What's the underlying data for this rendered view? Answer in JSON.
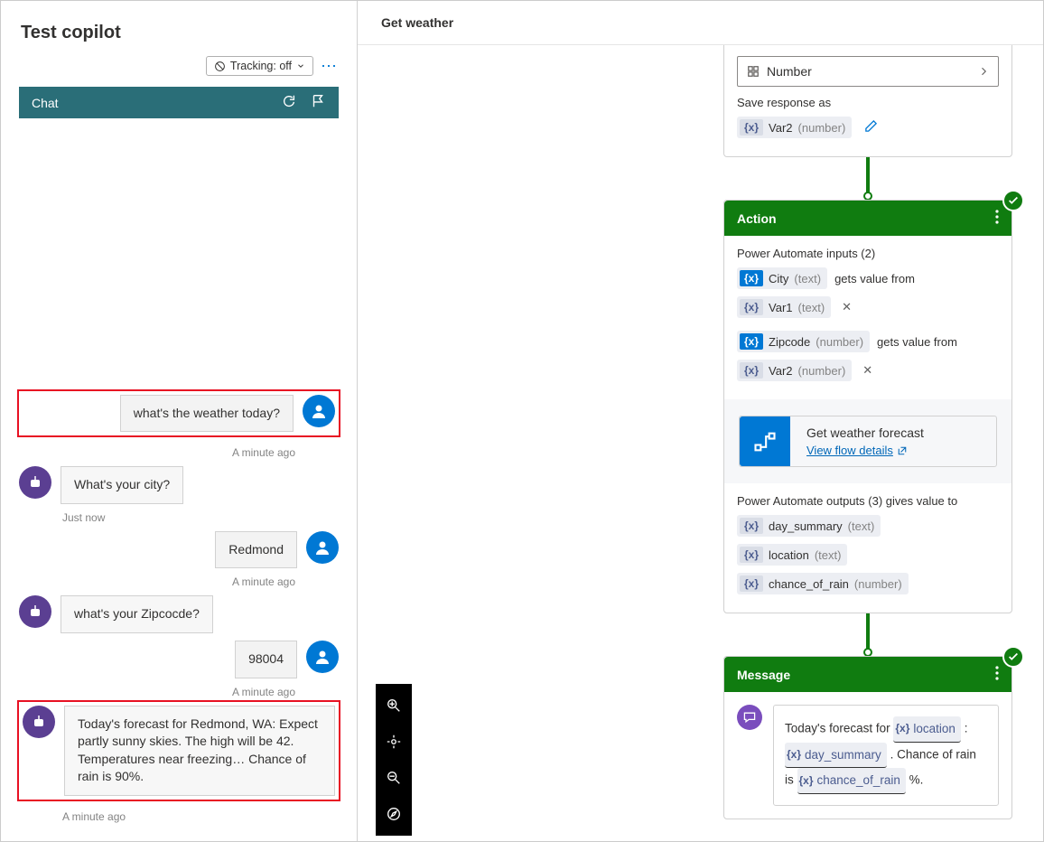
{
  "left": {
    "title": "Test copilot",
    "tracking_toggle": "Tracking: off",
    "chat_label": "Chat",
    "messages": [
      {
        "role": "user",
        "text": "what's the weather today?",
        "ts": "A minute ago",
        "highlighted": true
      },
      {
        "role": "bot",
        "text": "What's your city?",
        "ts": "Just now"
      },
      {
        "role": "user",
        "text": "Redmond",
        "ts": "A minute ago"
      },
      {
        "role": "bot",
        "text": "what's your Zipcocde?",
        "ts": ""
      },
      {
        "role": "user",
        "text": "98004",
        "ts": "A minute ago"
      },
      {
        "role": "bot",
        "text": "Today's forecast for Redmond, WA: Expect partly sunny skies. The high will be 42. Temperatures near freezing… Chance of rain is 90%.",
        "ts": "A minute ago",
        "highlighted": true
      }
    ]
  },
  "right": {
    "header": "Get weather",
    "response_dropdown": "Number",
    "save_response_label": "Save response as",
    "save_response_var": {
      "name": "Var2",
      "type": "number"
    },
    "action_node": {
      "title": "Action",
      "inputs_label": "Power Automate inputs (2)",
      "inputs": [
        {
          "param": {
            "name": "City",
            "type": "text"
          },
          "verb": "gets value from",
          "var": {
            "name": "Var1",
            "type": "text"
          }
        },
        {
          "param": {
            "name": "Zipcode",
            "type": "number"
          },
          "verb": "gets value from",
          "var": {
            "name": "Var2",
            "type": "number"
          }
        }
      ],
      "flow_title": "Get weather forecast",
      "flow_link": "View flow details",
      "outputs_label": "Power Automate outputs (3) gives value to",
      "outputs": [
        {
          "name": "day_summary",
          "type": "text"
        },
        {
          "name": "location",
          "type": "text"
        },
        {
          "name": "chance_of_rain",
          "type": "number"
        }
      ]
    },
    "message_node": {
      "title": "Message",
      "prefix": "Today's forecast for ",
      "var1": "location",
      "mid1": " :",
      "var2": "day_summary",
      "mid2": " . Chance of rain is ",
      "var3": "chance_of_rain",
      "suffix": " %."
    }
  }
}
